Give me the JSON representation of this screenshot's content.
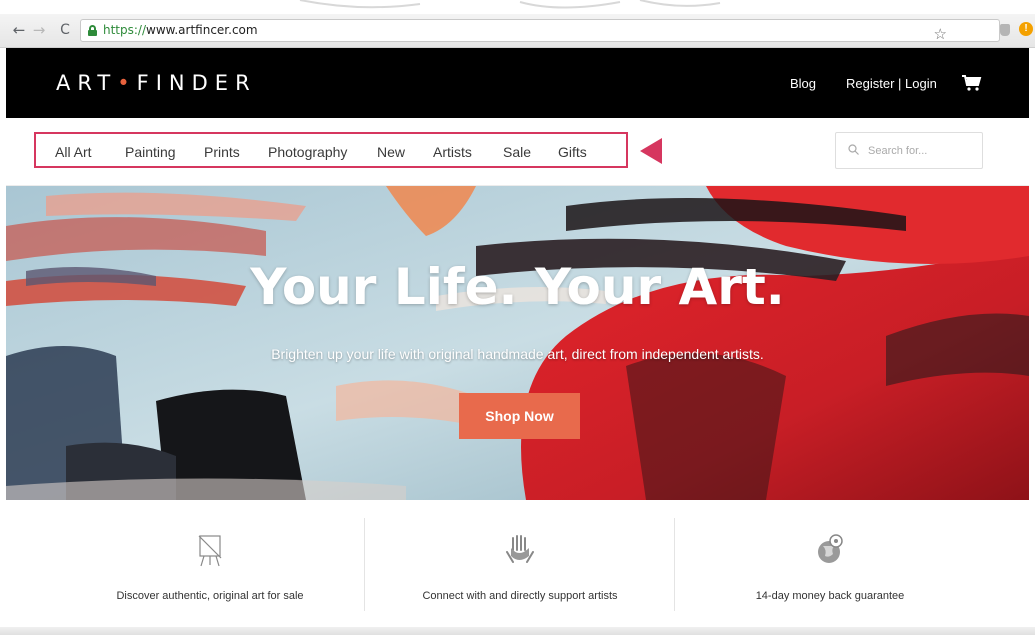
{
  "browser": {
    "url_scheme": "https://",
    "url_host": "www.artfincer.com"
  },
  "header": {
    "logo_left": "ART",
    "logo_dot": "•",
    "logo_right": "FINDER",
    "blog": "Blog",
    "register_login": "Register | Login"
  },
  "nav": {
    "items": [
      "All Art",
      "Painting",
      "Prints",
      "Photography",
      "New",
      "Artists",
      "Sale",
      "Gifts"
    ]
  },
  "search": {
    "placeholder": "Search for..."
  },
  "hero": {
    "title": "Your Life. Your Art.",
    "subtitle": "Brighten up your life with original handmade art, direct from independent artists.",
    "cta": "Shop Now"
  },
  "features": [
    {
      "caption": "Discover authentic, original art for sale",
      "icon": "easel-icon"
    },
    {
      "caption": "Connect with and directly support artists",
      "icon": "hands-icon"
    },
    {
      "caption": "14-day money back guarantee",
      "icon": "globe-icon"
    }
  ],
  "colors": {
    "accent": "#e86a4c",
    "highlight": "#d6365f",
    "header_bg": "#000000"
  }
}
